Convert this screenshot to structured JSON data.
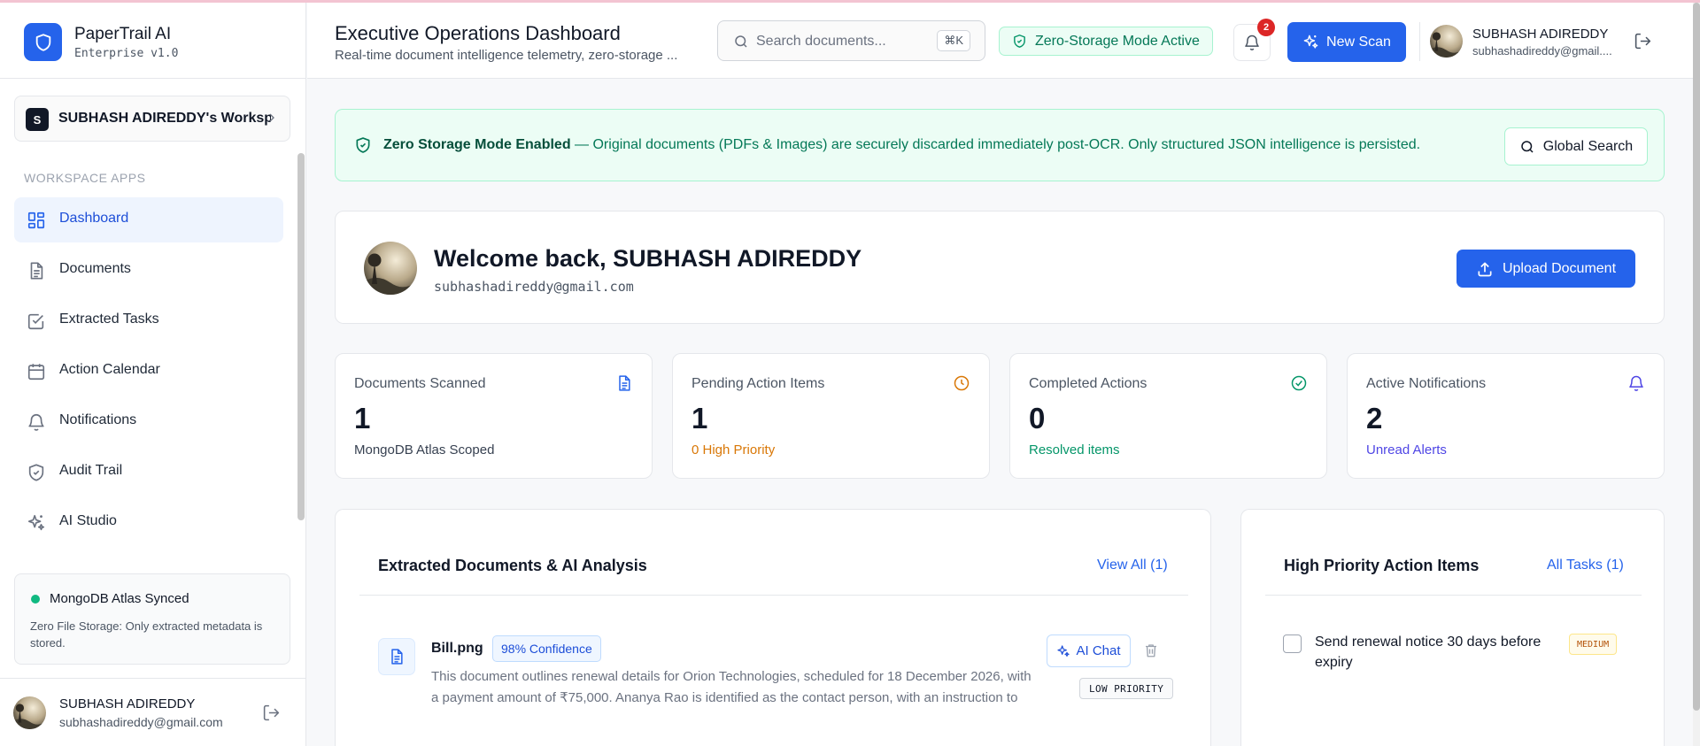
{
  "brand": {
    "name": "PaperTrail AI",
    "version": "Enterprise v1.0"
  },
  "workspace": {
    "initial": "S",
    "name": "SUBHASH ADIREDDY's Workspace"
  },
  "sidebar": {
    "section_label": "WORKSPACE APPS",
    "items": [
      {
        "label": "Dashboard",
        "icon": "dashboard-grid-icon",
        "active": true
      },
      {
        "label": "Documents",
        "icon": "document-icon"
      },
      {
        "label": "Extracted Tasks",
        "icon": "checkbox-icon"
      },
      {
        "label": "Action Calendar",
        "icon": "calendar-icon"
      },
      {
        "label": "Notifications",
        "icon": "bell-icon"
      },
      {
        "label": "Audit Trail",
        "icon": "shield-icon"
      },
      {
        "label": "AI Studio",
        "icon": "sparkles-icon"
      }
    ],
    "sync": {
      "title": "MongoDB Atlas Synced",
      "text": "Zero File Storage: Only extracted metadata is stored."
    },
    "user": {
      "name": "SUBHASH ADIREDDY",
      "email": "subhashadireddy@gmail.com"
    }
  },
  "header": {
    "title": "Executive Operations Dashboard",
    "subtitle": "Real-time document intelligence telemetry, zero-storage ...",
    "search_placeholder": "Search documents...",
    "search_shortcut": "⌘K",
    "zero_storage_badge": "Zero-Storage Mode Active",
    "notification_count": "2",
    "new_scan_label": "New Scan",
    "user": {
      "name": "SUBHASH ADIREDDY",
      "email": "subhashadireddy@gmail...."
    }
  },
  "banner": {
    "title": "Zero Storage Mode Enabled",
    "text": " — Original documents (PDFs & Images) are securely discarded immediately post-OCR. Only structured JSON intelligence is persisted.",
    "button": "Global Search"
  },
  "welcome": {
    "title": "Welcome back, SUBHASH ADIREDDY",
    "email": "subhashadireddy@gmail.com",
    "upload_label": "Upload Document"
  },
  "stats": [
    {
      "label": "Documents Scanned",
      "value": "1",
      "sub": "MongoDB Atlas Scoped",
      "color": "#2563eb"
    },
    {
      "label": "Pending Action Items",
      "value": "1",
      "sub": "0 High Priority",
      "color": "#d97706"
    },
    {
      "label": "Completed Actions",
      "value": "0",
      "sub": "Resolved items",
      "color": "#059669"
    },
    {
      "label": "Active Notifications",
      "value": "2",
      "sub": "Unread Alerts",
      "color": "#4f46e5"
    }
  ],
  "documents_panel": {
    "title": "Extracted Documents & AI Analysis",
    "view_all": "View All (1)",
    "doc": {
      "name": "Bill.png",
      "confidence": "98% Confidence",
      "description": "This document outlines renewal details for Orion Technologies, scheduled for 18 December 2026, with a payment amount of ₹75,000. Ananya Rao is identified as the contact person, with an instruction to sen...",
      "ai_chat": "AI Chat",
      "priority": "LOW PRIORITY"
    }
  },
  "tasks_panel": {
    "title": "High Priority Action Items",
    "all_tasks": "All Tasks (1)",
    "task": {
      "text": "Send renewal notice 30 days before expiry",
      "priority": "MEDIUM"
    }
  }
}
